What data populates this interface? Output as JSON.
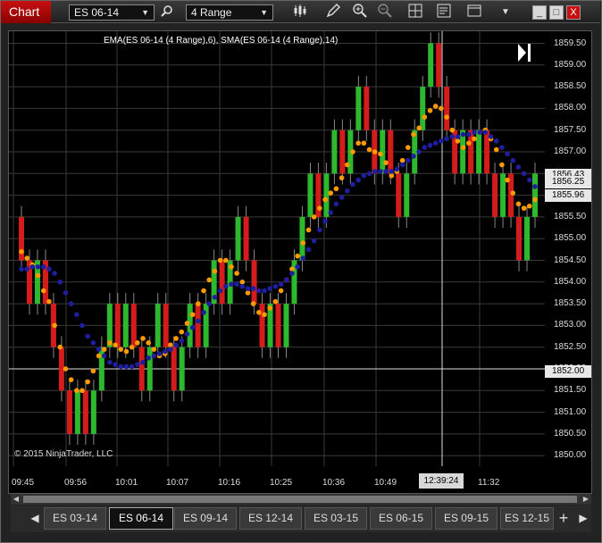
{
  "window": {
    "title": "Chart",
    "instrument": "ES 06-14",
    "bar_type": "4 Range",
    "minimize": "_",
    "maximize": "□",
    "close": "X"
  },
  "toolbar": {
    "search_icon": "search-icon",
    "chart_style_icon": "candlestick-icon",
    "draw_icon": "pencil-icon",
    "zoom_in_icon": "zoom-in-icon",
    "zoom_out_icon": "zoom-out-icon",
    "properties_icon": "grid-icon",
    "data_box_icon": "data-box-icon",
    "layout_icon": "layout-icon"
  },
  "indicator_label": "EMA(ES 06-14 (4 Range),6), SMA(ES 06-14 (4 Range),14)",
  "copyright": "© 2015 NinjaTrader, LLC",
  "price_ticks": [
    "1859.50",
    "1859.00",
    "1858.50",
    "1858.00",
    "1857.50",
    "1857.00",
    "1856.50",
    "1856.00",
    "1855.50",
    "1855.00",
    "1854.50",
    "1854.00",
    "1853.50",
    "1853.00",
    "1852.50",
    "1852.00",
    "1851.50",
    "1851.00",
    "1850.50",
    "1850.00"
  ],
  "price_markers": {
    "top": "1856.43",
    "ema": "1856.25",
    "sma": "1855.96",
    "cursor": "1852.00"
  },
  "time_ticks": [
    "09:45",
    "09:56",
    "10:01",
    "10:07",
    "10:16",
    "10:25",
    "10:36",
    "10:49",
    "12:39:24",
    "11:32"
  ],
  "tabs": [
    "ES 03-14",
    "ES 06-14",
    "ES 09-14",
    "ES 12-14",
    "ES 03-15",
    "ES 06-15",
    "ES 09-15",
    "ES 12-15"
  ],
  "active_tab": "ES 06-14",
  "colors": {
    "up": "#2db82d",
    "down": "#d41c1c",
    "ema": "#ff9a00",
    "sma": "#1e1e9e",
    "grid": "#3a3a3a"
  },
  "chart_data": {
    "type": "candlestick",
    "ylim": [
      1849.75,
      1859.75
    ],
    "series": [
      {
        "name": "EMA(ES 06-14 (4 Range),6)",
        "values": [
          1854.7,
          1854.55,
          1854.4,
          1854.15,
          1853.8,
          1853.55,
          1853.0,
          1852.5,
          1852.0,
          1851.75,
          1851.5,
          1851.5,
          1851.7,
          1851.95,
          1852.3,
          1852.45,
          1852.6,
          1852.55,
          1852.45,
          1852.4,
          1852.5,
          1852.6,
          1852.7,
          1852.6,
          1852.45,
          1852.3,
          1852.35,
          1852.55,
          1852.7,
          1852.85,
          1853.05,
          1853.25,
          1853.5,
          1853.8,
          1854.05,
          1854.25,
          1854.5,
          1854.5,
          1854.35,
          1854.2,
          1854.0,
          1853.75,
          1853.5,
          1853.3,
          1853.25,
          1853.4,
          1853.55,
          1853.8,
          1854.05,
          1854.3,
          1854.6,
          1854.9,
          1855.2,
          1855.5,
          1855.7,
          1855.9,
          1856.05,
          1856.15,
          1856.4,
          1856.7,
          1857.0,
          1857.2,
          1857.2,
          1857.05,
          1857.0,
          1856.95,
          1856.75,
          1856.45,
          1856.55,
          1856.8,
          1857.1,
          1857.4,
          1857.55,
          1857.8,
          1857.95,
          1858.05,
          1858.0,
          1857.8,
          1857.5,
          1857.25,
          1857.1,
          1857.2,
          1857.3,
          1857.45,
          1857.5,
          1857.3,
          1857.05,
          1856.7,
          1856.35,
          1856.05,
          1855.8,
          1855.7,
          1855.75,
          1855.9
        ]
      },
      {
        "name": "SMA(ES 06-14 (4 Range),14)",
        "values": [
          1854.3,
          1854.3,
          1854.35,
          1854.35,
          1854.35,
          1854.3,
          1854.2,
          1854.0,
          1853.75,
          1853.5,
          1853.25,
          1853.0,
          1852.75,
          1852.6,
          1852.45,
          1852.3,
          1852.15,
          1852.1,
          1852.05,
          1852.05,
          1852.05,
          1852.1,
          1852.15,
          1852.25,
          1852.3,
          1852.35,
          1852.4,
          1852.45,
          1852.55,
          1852.65,
          1852.8,
          1852.95,
          1853.1,
          1853.3,
          1853.5,
          1853.65,
          1853.8,
          1853.9,
          1853.95,
          1853.95,
          1853.9,
          1853.85,
          1853.85,
          1853.8,
          1853.8,
          1853.85,
          1853.9,
          1853.95,
          1854.05,
          1854.2,
          1854.35,
          1854.55,
          1854.75,
          1854.95,
          1855.2,
          1855.4,
          1855.6,
          1855.8,
          1855.95,
          1856.1,
          1856.25,
          1856.35,
          1856.45,
          1856.5,
          1856.55,
          1856.55,
          1856.55,
          1856.55,
          1856.6,
          1856.7,
          1856.8,
          1856.9,
          1857.0,
          1857.1,
          1857.15,
          1857.2,
          1857.25,
          1857.3,
          1857.35,
          1857.35,
          1857.4,
          1857.4,
          1857.45,
          1857.45,
          1857.45,
          1857.35,
          1857.25,
          1857.1,
          1856.95,
          1856.8,
          1856.65,
          1856.5,
          1856.35,
          1856.2
        ]
      }
    ],
    "candles": [
      [
        1855.5,
        1854.5,
        1855.5,
        1854.5
      ],
      [
        1854.5,
        1853.5,
        1854.5,
        1853.5
      ],
      [
        1853.5,
        1854.5,
        1854.5,
        1853.5
      ],
      [
        1854.5,
        1853.5,
        1854.5,
        1853.5
      ],
      [
        1853.5,
        1852.5,
        1853.5,
        1852.5
      ],
      [
        1852.5,
        1851.5,
        1852.5,
        1851.5
      ],
      [
        1851.5,
        1850.5,
        1851.5,
        1850.5
      ],
      [
        1850.5,
        1851.5,
        1851.5,
        1850.5
      ],
      [
        1851.5,
        1850.5,
        1851.5,
        1850.5
      ],
      [
        1850.5,
        1851.5,
        1851.5,
        1850.5
      ],
      [
        1851.5,
        1852.5,
        1852.5,
        1851.5
      ],
      [
        1852.5,
        1853.5,
        1853.5,
        1852.5
      ],
      [
        1853.5,
        1852.5,
        1853.5,
        1852.5
      ],
      [
        1852.5,
        1853.5,
        1853.5,
        1852.5
      ],
      [
        1853.5,
        1852.5,
        1853.5,
        1852.5
      ],
      [
        1852.5,
        1851.5,
        1852.5,
        1851.5
      ],
      [
        1851.5,
        1852.5,
        1852.5,
        1851.5
      ],
      [
        1852.5,
        1853.5,
        1853.5,
        1852.5
      ],
      [
        1853.5,
        1852.5,
        1853.5,
        1852.5
      ],
      [
        1852.5,
        1851.5,
        1852.5,
        1851.5
      ],
      [
        1851.5,
        1852.5,
        1852.5,
        1851.5
      ],
      [
        1852.5,
        1853.5,
        1853.5,
        1852.5
      ],
      [
        1853.5,
        1852.5,
        1853.5,
        1852.5
      ],
      [
        1852.5,
        1853.5,
        1853.5,
        1852.5
      ],
      [
        1853.5,
        1854.5,
        1854.5,
        1853.5
      ],
      [
        1854.5,
        1853.5,
        1854.5,
        1853.5
      ],
      [
        1853.5,
        1854.5,
        1854.5,
        1853.5
      ],
      [
        1854.5,
        1855.5,
        1855.5,
        1854.5
      ],
      [
        1855.5,
        1854.5,
        1855.5,
        1854.5
      ],
      [
        1854.5,
        1853.5,
        1854.5,
        1853.5
      ],
      [
        1853.5,
        1852.5,
        1853.5,
        1852.5
      ],
      [
        1852.5,
        1853.5,
        1853.5,
        1852.5
      ],
      [
        1853.5,
        1852.5,
        1853.5,
        1852.5
      ],
      [
        1852.5,
        1853.5,
        1853.5,
        1852.5
      ],
      [
        1853.5,
        1854.5,
        1854.5,
        1853.5
      ],
      [
        1854.5,
        1855.5,
        1855.5,
        1854.5
      ],
      [
        1855.5,
        1856.5,
        1856.5,
        1855.5
      ],
      [
        1856.5,
        1855.5,
        1856.5,
        1855.5
      ],
      [
        1855.5,
        1856.5,
        1856.5,
        1855.5
      ],
      [
        1856.5,
        1857.5,
        1857.5,
        1856.5
      ],
      [
        1857.5,
        1856.5,
        1857.5,
        1856.5
      ],
      [
        1856.5,
        1857.5,
        1857.5,
        1856.5
      ],
      [
        1857.5,
        1858.5,
        1858.5,
        1857.5
      ],
      [
        1858.5,
        1857.5,
        1858.5,
        1857.5
      ],
      [
        1857.5,
        1856.5,
        1857.5,
        1856.5
      ],
      [
        1856.5,
        1857.5,
        1857.5,
        1856.5
      ],
      [
        1857.5,
        1856.5,
        1857.5,
        1856.5
      ],
      [
        1856.5,
        1855.5,
        1856.5,
        1855.5
      ],
      [
        1855.5,
        1856.5,
        1856.5,
        1855.5
      ],
      [
        1856.5,
        1857.5,
        1857.5,
        1856.5
      ],
      [
        1857.5,
        1858.5,
        1858.5,
        1857.5
      ],
      [
        1858.5,
        1859.5,
        1859.5,
        1858.5
      ],
      [
        1859.5,
        1858.5,
        1859.5,
        1858.5
      ],
      [
        1858.5,
        1857.5,
        1858.5,
        1857.5
      ],
      [
        1857.5,
        1856.5,
        1857.5,
        1856.5
      ],
      [
        1856.5,
        1857.5,
        1857.5,
        1856.5
      ],
      [
        1857.5,
        1856.5,
        1857.5,
        1856.5
      ],
      [
        1856.5,
        1857.5,
        1857.5,
        1856.5
      ],
      [
        1857.5,
        1856.5,
        1857.5,
        1856.5
      ],
      [
        1856.5,
        1855.5,
        1856.5,
        1855.5
      ],
      [
        1855.5,
        1856.5,
        1856.5,
        1855.5
      ],
      [
        1856.5,
        1855.5,
        1856.5,
        1855.5
      ],
      [
        1855.5,
        1854.5,
        1855.5,
        1854.5
      ],
      [
        1854.5,
        1855.5,
        1855.5,
        1854.5
      ],
      [
        1855.5,
        1856.5,
        1856.5,
        1855.5
      ]
    ]
  }
}
